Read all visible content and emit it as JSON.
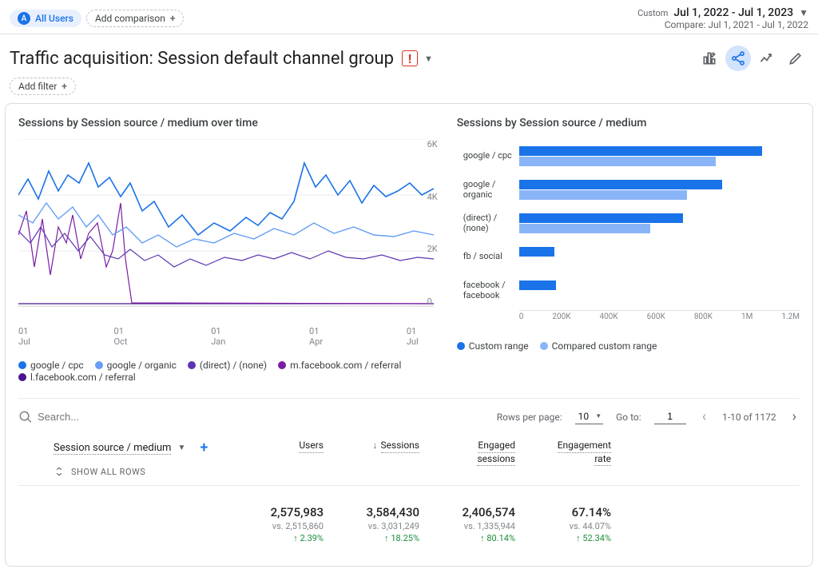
{
  "top": {
    "users_badge": "A",
    "users_label": "All Users",
    "add_comparison": "Add comparison",
    "custom_label": "Custom",
    "date_main": "Jul 1, 2022 - Jul 1, 2023",
    "compare_label": "Compare: Jul 1, 2021 - Jul 1, 2022"
  },
  "title": "Traffic acquisition: Session default channel group",
  "add_filter": "Add filter",
  "left_chart_title": "Sessions by Session source / medium over time",
  "right_chart_title": "Sessions by Session source / medium",
  "y_ticks": [
    "6K",
    "4K",
    "2K",
    "0"
  ],
  "x_ticks": [
    {
      "d": "01",
      "m": "Jul"
    },
    {
      "d": "01",
      "m": "Oct"
    },
    {
      "d": "01",
      "m": "Jan"
    },
    {
      "d": "01",
      "m": "Apr"
    },
    {
      "d": "01",
      "m": "Jul"
    }
  ],
  "line_legend": [
    {
      "label": "google / cpc",
      "color": "#1a73e8"
    },
    {
      "label": "google / organic",
      "color": "#669df6"
    },
    {
      "label": "(direct) / (none)",
      "color": "#5e35b1"
    },
    {
      "label": "m.facebook.com / referral",
      "color": "#7b1fa2"
    },
    {
      "label": "l.facebook.com / referral",
      "color": "#4a148c"
    }
  ],
  "bar_legend": [
    {
      "label": "Custom range",
      "color": "#1a73e8"
    },
    {
      "label": "Compared custom range",
      "color": "#8ab4f8"
    }
  ],
  "bars": [
    {
      "label": "google / cpc",
      "v1": 1040000,
      "v2": 840000
    },
    {
      "label": "google / organic",
      "v1": 870000,
      "v2": 720000
    },
    {
      "label": "(direct) / (none)",
      "v1": 700000,
      "v2": 560000
    },
    {
      "label": "fb / social",
      "v1": 150000,
      "v2": 0
    },
    {
      "label": "facebook / facebook",
      "v1": 160000,
      "v2": 0
    }
  ],
  "bar_max": 1200000,
  "bar_ticks": [
    "0",
    "200K",
    "400K",
    "600K",
    "800K",
    "1M",
    "1.2M"
  ],
  "search_placeholder": "Search...",
  "rows_label": "Rows per page:",
  "rows_value": "10",
  "goto_label": "Go to:",
  "goto_value": "1",
  "range_text": "1-10 of 1172",
  "dim_header": "Session source / medium",
  "show_all": "SHOW ALL ROWS",
  "metrics": [
    {
      "name": "Users",
      "sort": false
    },
    {
      "name": "Sessions",
      "sort": true
    },
    {
      "name": "Engaged sessions",
      "sort": false,
      "two_line": true,
      "l1": "Engaged",
      "l2": "sessions"
    },
    {
      "name": "Engagement rate",
      "sort": false,
      "two_line": true,
      "l1": "Engagement",
      "l2": "rate"
    }
  ],
  "summary": [
    {
      "val": "2,575,983",
      "vs": "vs. 2,515,860",
      "delta": "2.39%"
    },
    {
      "val": "3,584,430",
      "vs": "vs. 3,031,249",
      "delta": "18.25%"
    },
    {
      "val": "2,406,574",
      "vs": "vs. 1,335,944",
      "delta": "80.14%"
    },
    {
      "val": "67.14%",
      "vs": "vs. 44.07%",
      "delta": "52.34%"
    }
  ],
  "chart_data": {
    "type": "line",
    "title": "Sessions by Session source / medium over time",
    "ylabel": "Sessions",
    "ylim": [
      0,
      6000
    ],
    "x_range": [
      "2022-07-01",
      "2023-07-01"
    ],
    "note": "daily values; approximate envelope per series",
    "series": [
      {
        "name": "google / cpc",
        "color": "#1a73e8",
        "approx_range": [
          2000,
          5200
        ]
      },
      {
        "name": "google / organic",
        "color": "#669df6",
        "approx_range": [
          1800,
          3600
        ]
      },
      {
        "name": "(direct) / (none)",
        "color": "#5e35b1",
        "approx_range": [
          1400,
          2800
        ]
      },
      {
        "name": "m.facebook.com / referral",
        "color": "#7b1fa2",
        "approx_range": [
          0,
          2800
        ],
        "drops_to_zero_after": "2022-10"
      },
      {
        "name": "l.facebook.com / referral",
        "color": "#4a148c",
        "approx_range": [
          0,
          200
        ]
      }
    ],
    "bar_companion": {
      "type": "bar",
      "title": "Sessions by Session source / medium",
      "categories": [
        "google / cpc",
        "google / organic",
        "(direct) / (none)",
        "fb / social",
        "facebook / facebook"
      ],
      "series": [
        {
          "name": "Custom range",
          "values": [
            1040000,
            870000,
            700000,
            150000,
            160000
          ]
        },
        {
          "name": "Compared custom range",
          "values": [
            840000,
            720000,
            560000,
            0,
            0
          ]
        }
      ],
      "xlim": [
        0,
        1200000
      ]
    }
  }
}
